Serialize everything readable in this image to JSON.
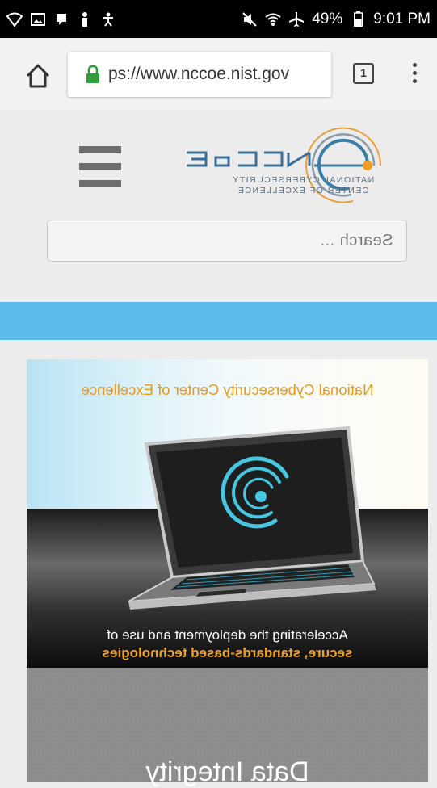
{
  "status_bar": {
    "left_icons": [
      "wifi-calling-icon",
      "image-icon",
      "notification-icon",
      "figure-icon",
      "accessibility-icon"
    ],
    "right_icons": [
      "mute-icon",
      "wifi-icon",
      "airplane-icon",
      "battery-icon"
    ],
    "battery": "49%",
    "time": "9:01 PM"
  },
  "browser": {
    "url_text": "ps://www.nccoe.nist.gov",
    "tab_count": "1",
    "icons": [
      "home-icon",
      "lock-icon",
      "tabs-icon",
      "overflow-menu-icon"
    ]
  },
  "header": {
    "logo": {
      "mark": "NCCoE",
      "line1": "NATIONAL CYBERSECURITY",
      "line2": "CENTER OF EXCELLENCE"
    },
    "menu_icon": "hamburger-icon"
  },
  "search": {
    "placeholder": "Search ..."
  },
  "banner": {
    "title": "National Cybersecurity Center of Excellence",
    "subtitle_line1": "Accelerating the deployment and use of",
    "subtitle_line2": "secure, standards-based technologies"
  },
  "tile": {
    "title": "Data Integrity"
  },
  "colors": {
    "accent_blue": "#5cb9ec",
    "banner_orange": "#e89a1c",
    "lock_green": "#2e9d3a"
  }
}
